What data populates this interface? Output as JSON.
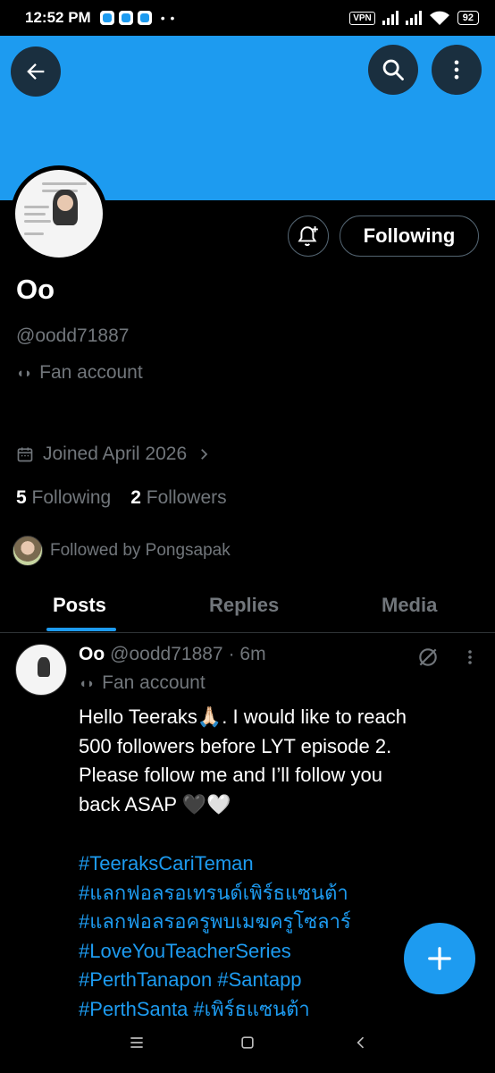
{
  "status_bar": {
    "time": "12:52 PM",
    "more": "• •",
    "vpn": "VPN",
    "battery": "92"
  },
  "header": {
    "back_icon": "arrow-left-icon",
    "search_icon": "search-icon",
    "more_icon": "more-vertical-icon",
    "banner_color": "#1d9bf0"
  },
  "profile": {
    "display_name": "Oo",
    "handle": "@oodd71887",
    "bio_icon": "theater-masks-icon",
    "bio": "Fan account",
    "joined": "Joined April 2026",
    "following_count": "5",
    "following_label": "Following",
    "followers_count": "2",
    "followers_label": "Followers",
    "followed_by": "Followed by Pongsapak",
    "follow_button": "Following"
  },
  "tabs": [
    {
      "label": "Posts",
      "active": true
    },
    {
      "label": "Replies",
      "active": false
    },
    {
      "label": "Media",
      "active": false
    }
  ],
  "post": {
    "name": "Oo",
    "handle": "@oodd71887",
    "time": "· 6m",
    "bio": "Fan account",
    "body_lines": [
      "Hello Teeraks🙏🏻. I would like to reach",
      "500 followers before LYT episode 2.",
      "Please follow me and I’ll follow you",
      "back ASAP 🖤🤍"
    ],
    "hashtags": [
      "#TeeraksCariTeman",
      "#แลกฟอลรอเทรนด์เพิร์ธแซนต้า",
      "#แลกฟอลรอครูพบเมฆครูโซลาร์",
      "#LoveYouTeacherSeries",
      "#PerthTanapon #Santapp",
      "#PerthSanta #เพิร์ธแซนต้า"
    ]
  },
  "fab": {
    "icon": "plus-icon",
    "color": "#1d9bf0"
  },
  "nav": {
    "menu_icon": "menu-icon",
    "home_icon": "square-icon",
    "back_icon": "chevron-left-icon"
  }
}
